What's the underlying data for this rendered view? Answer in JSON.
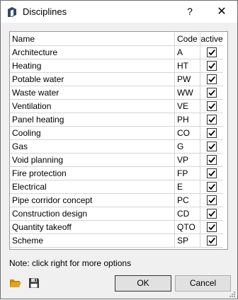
{
  "window": {
    "title": "Disciplines",
    "help_label": "?",
    "close_label": "✕"
  },
  "grid": {
    "headers": {
      "name": "Name",
      "code": "Code",
      "active": "active"
    },
    "rows": [
      {
        "name": "Architecture",
        "code": "A",
        "active": true
      },
      {
        "name": "Heating",
        "code": "HT",
        "active": true
      },
      {
        "name": "Potable water",
        "code": "PW",
        "active": true
      },
      {
        "name": "Waste water",
        "code": "WW",
        "active": true
      },
      {
        "name": "Ventilation",
        "code": "VE",
        "active": true
      },
      {
        "name": "Panel heating",
        "code": "PH",
        "active": true
      },
      {
        "name": "Cooling",
        "code": "CO",
        "active": true
      },
      {
        "name": "Gas",
        "code": "G",
        "active": true
      },
      {
        "name": "Void planning",
        "code": "VP",
        "active": true
      },
      {
        "name": "Fire protection",
        "code": "FP",
        "active": true
      },
      {
        "name": "Electrical",
        "code": "E",
        "active": true
      },
      {
        "name": "Pipe corridor concept",
        "code": "PC",
        "active": true
      },
      {
        "name": "Construction design",
        "code": "CD",
        "active": true
      },
      {
        "name": "Quantity takeoff",
        "code": "QTO",
        "active": true
      },
      {
        "name": "Scheme",
        "code": "SP",
        "active": true
      }
    ]
  },
  "note": "Note: click right for more options",
  "buttons": {
    "ok": "OK",
    "cancel": "Cancel"
  },
  "icons": {
    "app": "app-logo-icon",
    "open": "folder-open-icon",
    "save": "floppy-disk-icon",
    "check": "checkmark-icon"
  },
  "colors": {
    "folder": "#e8a317",
    "titlebar": "#ffffff",
    "dialog": "#f0f0f0"
  }
}
